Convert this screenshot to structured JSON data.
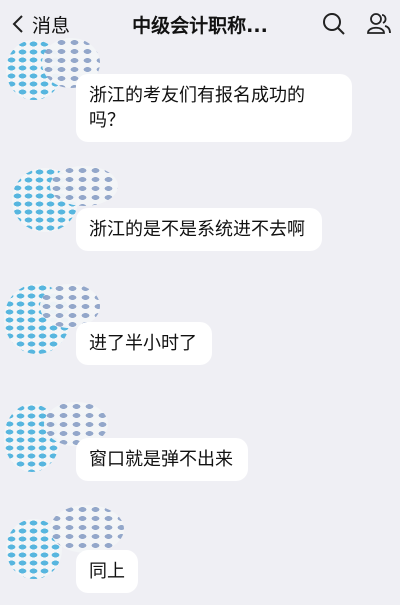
{
  "header": {
    "back_label": "消息",
    "title": "中级会计职称..."
  },
  "messages": [
    {
      "text": "浙江的考友们有报名成功的吗？"
    },
    {
      "text": "浙江的是不是系统进不去啊"
    },
    {
      "text": "进了半小时了"
    },
    {
      "text": "窗口就是弹不出来"
    },
    {
      "text": "同上"
    }
  ],
  "icons": {
    "back": "chevron-left-icon",
    "search": "search-icon",
    "group": "group-members-icon"
  }
}
